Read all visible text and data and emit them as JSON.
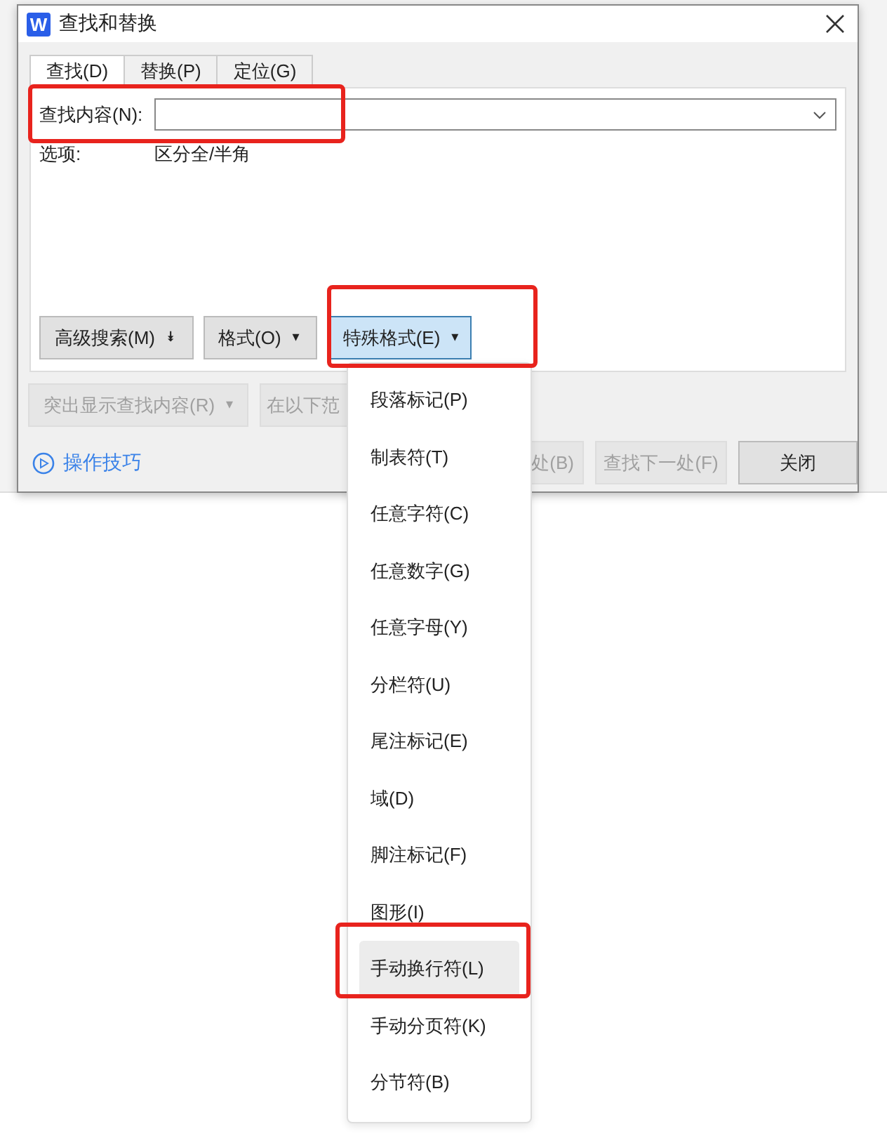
{
  "window": {
    "title": "查找和替换",
    "app_icon": "W"
  },
  "tabs": [
    {
      "label": "查找(D)",
      "selected": true
    },
    {
      "label": "替换(P)",
      "selected": false
    },
    {
      "label": "定位(G)",
      "selected": false
    }
  ],
  "find_field": {
    "label": "查找内容(N):"
  },
  "options": {
    "label": "选项:",
    "value": "区分全/半角"
  },
  "format_buttons": [
    {
      "label": "高级搜索(M)",
      "caret": "⯯",
      "pressed": false
    },
    {
      "label": "格式(O)",
      "caret": "▾",
      "pressed": false
    },
    {
      "label": "特殊格式(E)",
      "caret": "▾",
      "pressed": true
    }
  ],
  "second_row": [
    {
      "label": "突出显示查找内容(R)",
      "caret": "▾",
      "disabled": true
    },
    {
      "label": "在以下范",
      "disabled": true
    }
  ],
  "tips_link": "操作技巧",
  "bottom_buttons": [
    {
      "label": "处(B)",
      "disabled": true
    },
    {
      "label": "查找下一处(F)",
      "disabled": true
    },
    {
      "label": "关闭",
      "disabled": false
    }
  ],
  "menu": [
    {
      "label": "段落标记(P)",
      "hovered": false
    },
    {
      "label": "制表符(T)",
      "hovered": false
    },
    {
      "label": "任意字符(C)",
      "hovered": false
    },
    {
      "label": "任意数字(G)",
      "hovered": false
    },
    {
      "label": "任意字母(Y)",
      "hovered": false
    },
    {
      "label": "分栏符(U)",
      "hovered": false
    },
    {
      "label": "尾注标记(E)",
      "hovered": false
    },
    {
      "label": "域(D)",
      "hovered": false
    },
    {
      "label": "脚注标记(F)",
      "hovered": false
    },
    {
      "label": "图形(I)",
      "hovered": false
    },
    {
      "label": "手动换行符(L)",
      "hovered": true
    },
    {
      "label": "手动分页符(K)",
      "hovered": false
    },
    {
      "label": "分节符(B)",
      "hovered": false
    }
  ],
  "annotations": [
    {
      "kind": "highlight-frame"
    },
    {
      "kind": "highlight-frame"
    },
    {
      "kind": "highlight-frame"
    }
  ]
}
